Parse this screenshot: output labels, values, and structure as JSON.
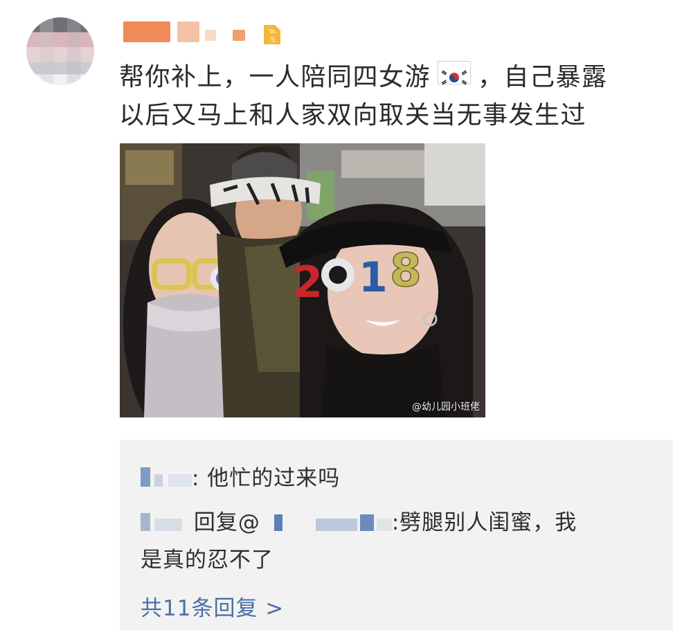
{
  "post": {
    "text_line1_a": "帮你补上，一人陪同四女游",
    "text_line1_b": "，自己暴露",
    "text_line2": "以后又马上和人家双向取关当无事发生过",
    "flag_icon": "korea-flag-icon"
  },
  "photo": {
    "glasses_text": "2018",
    "watermark": "@幼儿园小班佬"
  },
  "comments": {
    "reply1_text": ": 他忙的过来吗",
    "reply2_prefix": "回复@",
    "reply2_text": ":劈腿别人闺蜜，我",
    "reply2_text_cont": "是真的忍不了",
    "more_replies": "共11条回复 >"
  },
  "colors": {
    "link": "#4a6fa5",
    "comment_bg": "#f2f2f2",
    "username_redact": "#f0a070"
  }
}
